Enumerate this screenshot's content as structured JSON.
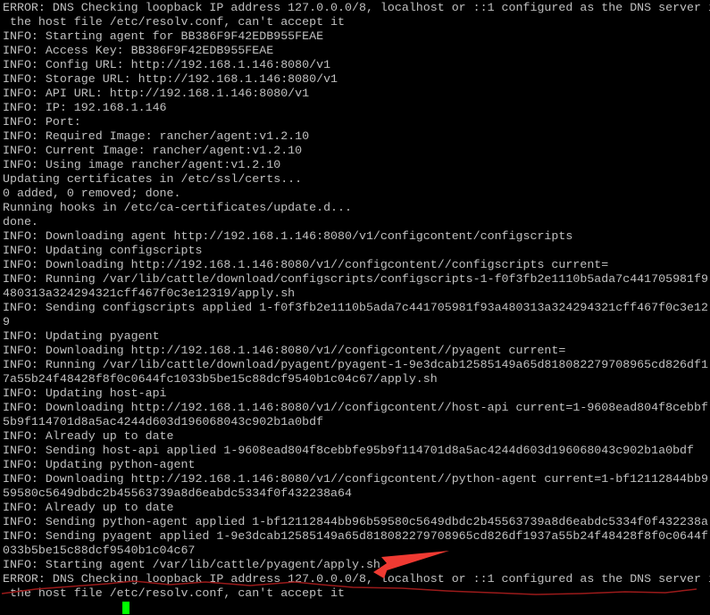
{
  "terminal": {
    "lines": [
      "ERROR: DNS Checking loopback IP address 127.0.0.0/8, localhost or ::1 configured as the DNS server in",
      " the host file /etc/resolv.conf, can't accept it",
      "INFO: Starting agent for BB386F9F42EDB955FEAE",
      "INFO: Access Key: BB386F9F42EDB955FEAE",
      "INFO: Config URL: http://192.168.1.146:8080/v1",
      "INFO: Storage URL: http://192.168.1.146:8080/v1",
      "INFO: API URL: http://192.168.1.146:8080/v1",
      "INFO: IP: 192.168.1.146",
      "INFO: Port:",
      "INFO: Required Image: rancher/agent:v1.2.10",
      "INFO: Current Image: rancher/agent:v1.2.10",
      "INFO: Using image rancher/agent:v1.2.10",
      "Updating certificates in /etc/ssl/certs...",
      "0 added, 0 removed; done.",
      "Running hooks in /etc/ca-certificates/update.d...",
      "done.",
      "INFO: Downloading agent http://192.168.1.146:8080/v1/configcontent/configscripts",
      "INFO: Updating configscripts",
      "INFO: Downloading http://192.168.1.146:8080/v1//configcontent//configscripts current=",
      "INFO: Running /var/lib/cattle/download/configscripts/configscripts-1-f0f3fb2e1110b5ada7c441705981f9",
      "480313a324294321cff467f0c3e12319/apply.sh",
      "INFO: Sending configscripts applied 1-f0f3fb2e1110b5ada7c441705981f93a480313a324294321cff467f0c3e12",
      "9",
      "INFO: Updating pyagent",
      "INFO: Downloading http://192.168.1.146:8080/v1//configcontent//pyagent current=",
      "INFO: Running /var/lib/cattle/download/pyagent/pyagent-1-9e3dcab12585149a65d818082279708965cd826df1",
      "7a55b24f48428f8f0c0644fc1033b5be15c88dcf9540b1c04c67/apply.sh",
      "INFO: Updating host-api",
      "INFO: Downloading http://192.168.1.146:8080/v1//configcontent//host-api current=1-9608ead804f8cebbf",
      "5b9f114701d8a5ac4244d603d196068043c902b1a0bdf",
      "INFO: Already up to date",
      "INFO: Sending host-api applied 1-9608ead804f8cebbfe95b9f114701d8a5ac4244d603d196068043c902b1a0bdf",
      "INFO: Updating python-agent",
      "INFO: Downloading http://192.168.1.146:8080/v1//configcontent//python-agent current=1-bf12112844bb9",
      "59580c5649dbdc2b45563739a8d6eabdc5334f0f432238a64",
      "INFO: Already up to date",
      "INFO: Sending python-agent applied 1-bf12112844bb96b59580c5649dbdc2b45563739a8d6eabdc5334f0f432238a",
      "INFO: Sending pyagent applied 1-9e3dcab12585149a65d818082279708965cd826df1937a55b24f48428f8f0c0644f",
      "033b5be15c88dcf9540b1c04c67",
      "INFO: Starting agent /var/lib/cattle/pyagent/apply.sh",
      "ERROR: DNS Checking loopback IP address 127.0.0.0/8, localhost or ::1 configured as the DNS server in",
      " the host file /etc/resolv.conf, can't accept it"
    ],
    "text_color": "#c0c0c0",
    "background": "#000000",
    "cursor_color": "#00ff00",
    "annotation_color": "#e8302c"
  }
}
